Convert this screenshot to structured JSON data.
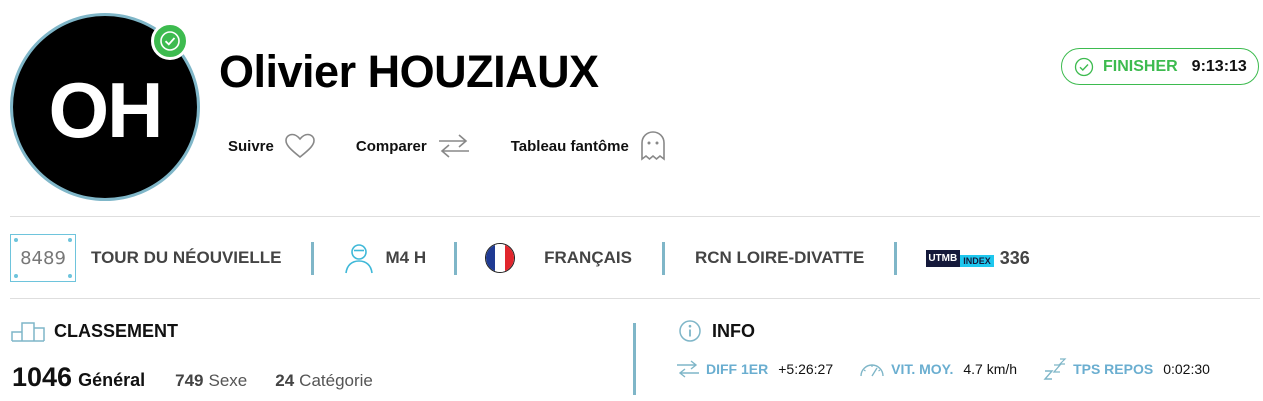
{
  "profile": {
    "initials": "OH",
    "name": "Olivier HOUZIAUX"
  },
  "actions": {
    "follow_label": "Suivre",
    "compare_label": "Comparer",
    "ghost_label": "Tableau fantôme"
  },
  "finisher": {
    "label": "FINISHER",
    "time": "9:13:13"
  },
  "info_bar": {
    "bib": "8489",
    "race": "TOUR DU NÉOUVIELLE",
    "category": "M4 H",
    "nationality": "FRANÇAIS",
    "club": "RCN LOIRE-DIVATTE",
    "utmb_logo_a": "UTMB",
    "utmb_logo_b": "INDEX",
    "utmb_index": "336"
  },
  "ranking": {
    "title": "CLASSEMENT",
    "general_value": "1046",
    "general_label": "Général",
    "sex_value": "749",
    "sex_label": "Sexe",
    "category_value": "24",
    "category_label": "Catégorie"
  },
  "info": {
    "title": "INFO",
    "diff_label": "DIFF 1ER",
    "diff_value": "+5:26:27",
    "speed_label": "VIT. MOY.",
    "speed_value": "4.7 km/h",
    "rest_label": "TPS REPOS",
    "rest_value": "0:02:30"
  },
  "colors": {
    "accent_green": "#3dbb4f",
    "accent_blue": "#6aaed0",
    "utmb_navy": "#14193a",
    "utmb_cyan": "#1ec7ee"
  },
  "icons": {
    "verified": "check-circle-icon",
    "follow": "heart-icon",
    "compare": "arrows-exchange-icon",
    "ghost": "ghost-icon",
    "finisher": "check-circle-icon",
    "category": "runner-person-icon",
    "flag": "flag-france-icon",
    "ranking": "podium-icon",
    "info": "info-circle-icon",
    "diff": "arrows-exchange-icon",
    "speed": "speedometer-icon",
    "rest": "sleep-zzz-icon"
  }
}
